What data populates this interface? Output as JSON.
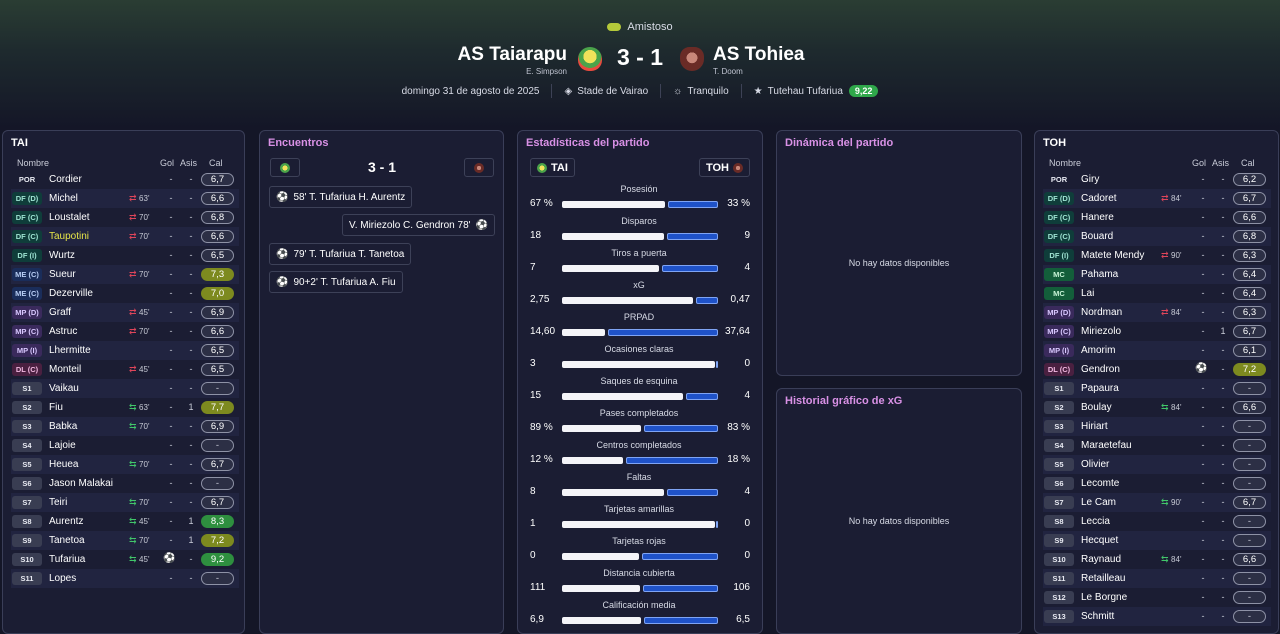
{
  "competition": "Amistoso",
  "home": {
    "name": "AS Taiarapu",
    "coach": "E. Simpson",
    "short": "TAI"
  },
  "away": {
    "name": "AS Tohiea",
    "coach": "T. Doom",
    "short": "TOH"
  },
  "score": "3 - 1",
  "info": {
    "date": "domingo 31 de agosto de 2025",
    "stadium": "Stade de Vairao",
    "weather": "Tranquilo",
    "motm": "Tutehau Tufariua",
    "motm_rating": "9,22"
  },
  "columns": {
    "name": "Nombre",
    "goals": "Gol",
    "assists": "Asis",
    "rating": "Cal"
  },
  "home_players": [
    {
      "pos": "POR",
      "name": "Cordier",
      "sub": "",
      "goals": "-",
      "assists": "-",
      "rating": "6,7"
    },
    {
      "pos": "DF (D)",
      "name": "Michel",
      "sub": "63'",
      "dir": "out",
      "goals": "-",
      "assists": "-",
      "rating": "6,6"
    },
    {
      "pos": "DF (C)",
      "name": "Loustalet",
      "sub": "70'",
      "dir": "out",
      "goals": "-",
      "assists": "-",
      "rating": "6,8"
    },
    {
      "pos": "DF (C)",
      "name": "Taupotini",
      "sub": "70'",
      "dir": "out",
      "goals": "-",
      "assists": "-",
      "rating": "6,6",
      "hl": true
    },
    {
      "pos": "DF (I)",
      "name": "Wurtz",
      "sub": "",
      "goals": "-",
      "assists": "-",
      "rating": "6,5"
    },
    {
      "pos": "ME (C)",
      "name": "Sueur",
      "sub": "70'",
      "dir": "out",
      "goals": "-",
      "assists": "-",
      "rating": "7,3",
      "rc": "y"
    },
    {
      "pos": "ME (C)",
      "name": "Dezerville",
      "sub": "",
      "goals": "-",
      "assists": "-",
      "rating": "7,0",
      "rc": "y"
    },
    {
      "pos": "MP (D)",
      "name": "Graff",
      "sub": "45'",
      "dir": "out",
      "goals": "-",
      "assists": "-",
      "rating": "6,9"
    },
    {
      "pos": "MP (C)",
      "name": "Astruc",
      "sub": "70'",
      "dir": "out",
      "goals": "-",
      "assists": "-",
      "rating": "6,6"
    },
    {
      "pos": "MP (I)",
      "name": "Lhermitte",
      "sub": "",
      "goals": "-",
      "assists": "-",
      "rating": "6,5"
    },
    {
      "pos": "DL (C)",
      "name": "Monteil",
      "sub": "45'",
      "dir": "out",
      "goals": "-",
      "assists": "-",
      "rating": "6,5"
    },
    {
      "pos": "S1",
      "name": "Vaikau",
      "sub": "",
      "goals": "-",
      "assists": "-",
      "rating": "-"
    },
    {
      "pos": "S2",
      "name": "Fiu",
      "sub": "63'",
      "dir": "in",
      "goals": "-",
      "assists": "1",
      "rating": "7,7",
      "rc": "y"
    },
    {
      "pos": "S3",
      "name": "Babka",
      "sub": "70'",
      "dir": "in",
      "goals": "-",
      "assists": "-",
      "rating": "6,9"
    },
    {
      "pos": "S4",
      "name": "Lajoie",
      "sub": "",
      "goals": "-",
      "assists": "-",
      "rating": "-"
    },
    {
      "pos": "S5",
      "name": "Heuea",
      "sub": "70'",
      "dir": "in",
      "goals": "-",
      "assists": "-",
      "rating": "6,7"
    },
    {
      "pos": "S6",
      "name": "Jason Malakai",
      "sub": "",
      "goals": "-",
      "assists": "-",
      "rating": "-"
    },
    {
      "pos": "S7",
      "name": "Teiri",
      "sub": "70'",
      "dir": "in",
      "goals": "-",
      "assists": "-",
      "rating": "6,7"
    },
    {
      "pos": "S8",
      "name": "Aurentz",
      "sub": "45'",
      "dir": "in",
      "goals": "-",
      "assists": "1",
      "rating": "8,3",
      "rc": "g"
    },
    {
      "pos": "S9",
      "name": "Tanetoa",
      "sub": "70'",
      "dir": "in",
      "goals": "-",
      "assists": "1",
      "rating": "7,2",
      "rc": "y"
    },
    {
      "pos": "S10",
      "name": "Tufariua",
      "sub": "45'",
      "dir": "in",
      "goals": "ball",
      "assists": "-",
      "rating": "9,2",
      "rc": "g"
    },
    {
      "pos": "S11",
      "name": "Lopes",
      "sub": "",
      "goals": "-",
      "assists": "-",
      "rating": "-"
    }
  ],
  "away_players": [
    {
      "pos": "POR",
      "name": "Giry",
      "sub": "",
      "goals": "-",
      "assists": "-",
      "rating": "6,2"
    },
    {
      "pos": "DF (D)",
      "name": "Cadoret",
      "sub": "84'",
      "dir": "out",
      "goals": "-",
      "assists": "-",
      "rating": "6,7"
    },
    {
      "pos": "DF (C)",
      "name": "Hanere",
      "sub": "",
      "goals": "-",
      "assists": "-",
      "rating": "6,6"
    },
    {
      "pos": "DF (C)",
      "name": "Bouard",
      "sub": "",
      "goals": "-",
      "assists": "-",
      "rating": "6,8"
    },
    {
      "pos": "DF (I)",
      "name": "Matete Mendy",
      "sub": "90'",
      "dir": "out",
      "goals": "-",
      "assists": "-",
      "rating": "6,3"
    },
    {
      "pos": "MC",
      "name": "Pahama",
      "sub": "",
      "goals": "-",
      "assists": "-",
      "rating": "6,4"
    },
    {
      "pos": "MC",
      "name": "Lai",
      "sub": "",
      "goals": "-",
      "assists": "-",
      "rating": "6,4"
    },
    {
      "pos": "MP (D)",
      "name": "Nordman",
      "sub": "84'",
      "dir": "out",
      "goals": "-",
      "assists": "-",
      "rating": "6,3"
    },
    {
      "pos": "MP (C)",
      "name": "Miriezolo",
      "sub": "",
      "goals": "-",
      "assists": "1",
      "rating": "6,7"
    },
    {
      "pos": "MP (I)",
      "name": "Amorim",
      "sub": "",
      "goals": "-",
      "assists": "-",
      "rating": "6,1"
    },
    {
      "pos": "DL (C)",
      "name": "Gendron",
      "sub": "",
      "goals": "ball",
      "assists": "-",
      "rating": "7,2",
      "rc": "y"
    },
    {
      "pos": "S1",
      "name": "Papaura",
      "sub": "",
      "goals": "-",
      "assists": "-",
      "rating": "-"
    },
    {
      "pos": "S2",
      "name": "Boulay",
      "sub": "84'",
      "dir": "in",
      "goals": "-",
      "assists": "-",
      "rating": "6,6"
    },
    {
      "pos": "S3",
      "name": "Hiriart",
      "sub": "",
      "goals": "-",
      "assists": "-",
      "rating": "-"
    },
    {
      "pos": "S4",
      "name": "Maraetefau",
      "sub": "",
      "goals": "-",
      "assists": "-",
      "rating": "-"
    },
    {
      "pos": "S5",
      "name": "Olivier",
      "sub": "",
      "goals": "-",
      "assists": "-",
      "rating": "-"
    },
    {
      "pos": "S6",
      "name": "Lecomte",
      "sub": "",
      "goals": "-",
      "assists": "-",
      "rating": "-"
    },
    {
      "pos": "S7",
      "name": "Le Cam",
      "sub": "90'",
      "dir": "in",
      "goals": "-",
      "assists": "-",
      "rating": "6,7"
    },
    {
      "pos": "S8",
      "name": "Leccia",
      "sub": "",
      "goals": "-",
      "assists": "-",
      "rating": "-"
    },
    {
      "pos": "S9",
      "name": "Hecquet",
      "sub": "",
      "goals": "-",
      "assists": "-",
      "rating": "-"
    },
    {
      "pos": "S10",
      "name": "Raynaud",
      "sub": "84'",
      "dir": "in",
      "goals": "-",
      "assists": "-",
      "rating": "6,6"
    },
    {
      "pos": "S11",
      "name": "Retailleau",
      "sub": "",
      "goals": "-",
      "assists": "-",
      "rating": "-"
    },
    {
      "pos": "S12",
      "name": "Le Borgne",
      "sub": "",
      "goals": "-",
      "assists": "-",
      "rating": "-"
    },
    {
      "pos": "S13",
      "name": "Schmitt",
      "sub": "",
      "goals": "-",
      "assists": "-",
      "rating": "-"
    }
  ],
  "encounters": {
    "title": "Encuentros",
    "score": "3 - 1",
    "events": [
      {
        "text": "58' T. Tufariua H. Aurentz",
        "side": "home"
      },
      {
        "text": "V. Miriezolo C. Gendron 78'",
        "side": "away"
      },
      {
        "text": "79' T. Tufariua T. Tanetoa",
        "side": "home"
      },
      {
        "text": "90+2' T. Tufariua A. Fiu",
        "side": "home"
      }
    ]
  },
  "stats": {
    "title": "Estadísticas del partido",
    "rows": [
      {
        "label": "Posesión",
        "home": "67 %",
        "away": "33 %",
        "hv": 67,
        "av": 33
      },
      {
        "label": "Disparos",
        "home": "18",
        "away": "9",
        "hv": 18,
        "av": 9
      },
      {
        "label": "Tiros a puerta",
        "home": "7",
        "away": "4",
        "hv": 7,
        "av": 4
      },
      {
        "label": "xG",
        "home": "2,75",
        "away": "0,47",
        "hv": 2.75,
        "av": 0.47
      },
      {
        "label": "PRPAD",
        "home": "14,60",
        "away": "37,64",
        "hv": 14.6,
        "av": 37.64
      },
      {
        "label": "Ocasiones claras",
        "home": "3",
        "away": "0",
        "hv": 3,
        "av": 0
      },
      {
        "label": "Saques de esquina",
        "home": "15",
        "away": "4",
        "hv": 15,
        "av": 4
      },
      {
        "label": "Pases completados",
        "home": "89 %",
        "away": "83 %",
        "hv": 89,
        "av": 83
      },
      {
        "label": "Centros completados",
        "home": "12 %",
        "away": "18 %",
        "hv": 12,
        "av": 18
      },
      {
        "label": "Faltas",
        "home": "8",
        "away": "4",
        "hv": 8,
        "av": 4
      },
      {
        "label": "Tarjetas amarillas",
        "home": "1",
        "away": "0",
        "hv": 1,
        "av": 0
      },
      {
        "label": "Tarjetas rojas",
        "home": "0",
        "away": "0",
        "hv": 0,
        "av": 0
      },
      {
        "label": "Distancia cubierta",
        "home": "111",
        "away": "106",
        "hv": 111,
        "av": 106
      },
      {
        "label": "Calificación media",
        "home": "6,9",
        "away": "6,5",
        "hv": 6.9,
        "av": 6.5
      }
    ]
  },
  "dynamics": {
    "title": "Dinámica del partido",
    "empty": "No hay datos disponibles"
  },
  "xg_history": {
    "title": "Historial gráfico de xG",
    "empty": "No hay datos disponibles"
  }
}
